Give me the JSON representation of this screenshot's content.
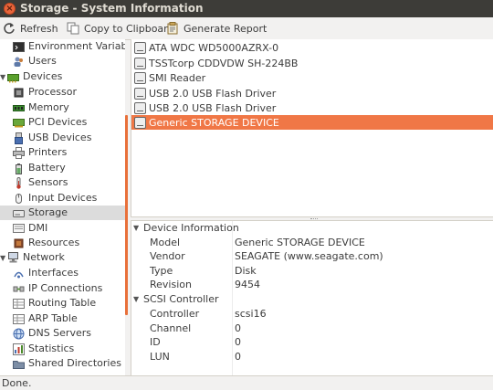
{
  "window": {
    "title": "Storage - System Information"
  },
  "toolbar": {
    "refresh": "Refresh",
    "copy": "Copy to Clipboard",
    "report": "Generate Report"
  },
  "tree": {
    "items": [
      {
        "label": "Environment Variables",
        "icon": "terminal-icon",
        "level": 1
      },
      {
        "label": "Users",
        "icon": "users-icon",
        "level": 1
      },
      {
        "label": "Devices",
        "icon": "devices-icon",
        "level": 0,
        "expanded": true
      },
      {
        "label": "Processor",
        "icon": "processor-icon",
        "level": 1
      },
      {
        "label": "Memory",
        "icon": "memory-icon",
        "level": 1
      },
      {
        "label": "PCI Devices",
        "icon": "pci-icon",
        "level": 1
      },
      {
        "label": "USB Devices",
        "icon": "usb-icon",
        "level": 1
      },
      {
        "label": "Printers",
        "icon": "printer-icon",
        "level": 1
      },
      {
        "label": "Battery",
        "icon": "battery-icon",
        "level": 1
      },
      {
        "label": "Sensors",
        "icon": "sensor-icon",
        "level": 1
      },
      {
        "label": "Input Devices",
        "icon": "input-devices-icon",
        "level": 1
      },
      {
        "label": "Storage",
        "icon": "storage-icon",
        "level": 1,
        "selected": true
      },
      {
        "label": "DMI",
        "icon": "dmi-icon",
        "level": 1
      },
      {
        "label": "Resources",
        "icon": "resources-icon",
        "level": 1
      },
      {
        "label": "Network",
        "icon": "network-icon",
        "level": 0,
        "expanded": true
      },
      {
        "label": "Interfaces",
        "icon": "interfaces-icon",
        "level": 1
      },
      {
        "label": "IP Connections",
        "icon": "ip-connections-icon",
        "level": 1
      },
      {
        "label": "Routing Table",
        "icon": "routing-table-icon",
        "level": 1
      },
      {
        "label": "ARP Table",
        "icon": "arp-table-icon",
        "level": 1
      },
      {
        "label": "DNS Servers",
        "icon": "dns-icon",
        "level": 1
      },
      {
        "label": "Statistics",
        "icon": "statistics-icon",
        "level": 1
      },
      {
        "label": "Shared Directories",
        "icon": "shared-directories-icon",
        "level": 1
      }
    ]
  },
  "devices": [
    {
      "label": "ATA WDC WD5000AZRX-0",
      "icon": "hard-disk-icon"
    },
    {
      "label": "TSSTcorp CDDVDW SH-224BB",
      "icon": "optical-drive-icon"
    },
    {
      "label": "SMI Reader",
      "icon": "drive-icon"
    },
    {
      "label": "USB 2.0 USB Flash Driver",
      "icon": "drive-icon"
    },
    {
      "label": "USB 2.0 USB Flash Driver",
      "icon": "drive-icon"
    },
    {
      "label": "Generic STORAGE DEVICE",
      "icon": "drive-icon",
      "selected": true
    }
  ],
  "details": {
    "groups": [
      {
        "title": "Device Information",
        "rows": [
          {
            "key": "Model",
            "value": "Generic STORAGE DEVICE"
          },
          {
            "key": "Vendor",
            "value": "SEAGATE (www.seagate.com)"
          },
          {
            "key": "Type",
            "value": "Disk"
          },
          {
            "key": "Revision",
            "value": "9454"
          }
        ]
      },
      {
        "title": "SCSI Controller",
        "rows": [
          {
            "key": "Controller",
            "value": "scsi16"
          },
          {
            "key": "Channel",
            "value": "0"
          },
          {
            "key": "ID",
            "value": "0"
          },
          {
            "key": "LUN",
            "value": "0"
          }
        ]
      }
    ]
  },
  "status": {
    "text": "Done."
  },
  "colors": {
    "accent": "#f07746",
    "titlebar": "#3d3c38",
    "close": "#e9653b"
  }
}
